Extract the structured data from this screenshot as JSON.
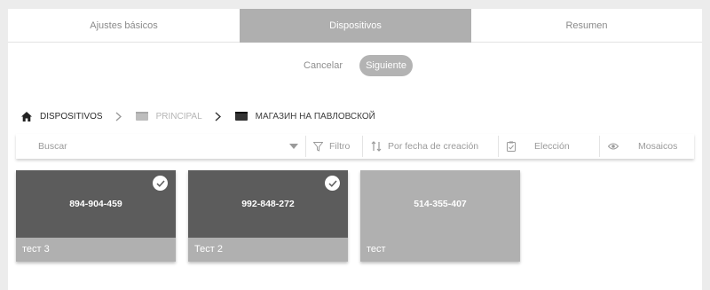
{
  "tabs": [
    {
      "label": "Ajustes básicos",
      "active": false
    },
    {
      "label": "Dispositivos",
      "active": true
    },
    {
      "label": "Resumen",
      "active": false
    }
  ],
  "actions": {
    "cancel_label": "Cancelar",
    "next_label": "Siguiente"
  },
  "breadcrumb": [
    {
      "label": "DISPOSITIVOS",
      "icon": "home-icon"
    },
    {
      "label": "PRINCIPAL",
      "icon": "folder-icon"
    },
    {
      "label": "МАГАЗИН НА ПАВЛОВСКОЙ",
      "icon": "folder-icon"
    }
  ],
  "toolbar": {
    "search_placeholder": "Buscar",
    "filter_label": "Filtro",
    "sort_label": "Por fecha de creación",
    "select_label": "Elección",
    "view_label": "Mosaicos"
  },
  "devices": [
    {
      "id": "894-904-459",
      "name": "тест 3",
      "selected": true
    },
    {
      "id": "992-848-272",
      "name": "Тест 2",
      "selected": true
    },
    {
      "id": "514-355-407",
      "name": "тест",
      "selected": false
    }
  ],
  "colors": {
    "selected_card": "#5c5c5c",
    "unselected_card": "#b0b0b0",
    "active_tab": "#afafaf",
    "background": "#ececec"
  }
}
